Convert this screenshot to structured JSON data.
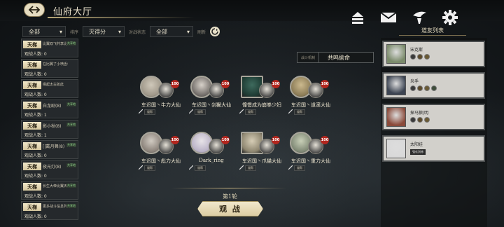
{
  "header": {
    "title": "仙府大厅"
  },
  "filters": {
    "f1": "全部",
    "label2": "排序",
    "f2": "灭得分",
    "label3": "对战状态",
    "f3": "全部",
    "label4": "刷新"
  },
  "rooms": [
    {
      "tag": "天梯",
      "name": "比翼双飞共享比翼",
      "badge": "共享地",
      "view": "观战人数: 0"
    },
    {
      "tag": "天梯",
      "name": "在比翼了小喷舌者",
      "badge": "",
      "view": "观战人数: 0"
    },
    {
      "tag": "天梯",
      "name": "缘起太古如此",
      "badge": "",
      "view": "观战人数: 0"
    },
    {
      "tag": "天梯",
      "name": "白龙剧(8)",
      "badge": "共享地",
      "view": "观战人数: 1",
      "big": true
    },
    {
      "tag": "天梯",
      "name": "影小秋(8)",
      "badge": "共享地",
      "view": "观战人数: 1",
      "big": true
    },
    {
      "tag": "天梯",
      "name": "[]戴月舞(8)",
      "badge": "共享地",
      "view": "观战人数: 0",
      "big": true
    },
    {
      "tag": "天梯",
      "name": "夜光灯(8)",
      "badge": "共享地",
      "view": "观战人数: 0",
      "big": true
    },
    {
      "tag": "天梯",
      "name": "长生大帝比翼天尊",
      "badge": "共享地",
      "view": "观战人数: 0"
    },
    {
      "tag": "天梯",
      "name": "更多战斗信息列表",
      "badge": "共享地",
      "view": "观战人数: 0"
    }
  ],
  "combat_mechanic": {
    "label": "战斗机制",
    "value": "共鸣偷命"
  },
  "fighters": [
    {
      "name": "车迟国丶牛力大仙",
      "hp": "100",
      "status": "道帮"
    },
    {
      "name": "车迟国丶剑獬大仙",
      "hp": "100",
      "status": "道帮"
    },
    {
      "name": "憧憬成为崩拳少妇",
      "hp": "100",
      "status": "道帮"
    },
    {
      "name": "车迟国丶道滚大仙",
      "hp": "100",
      "status": "道帮"
    },
    {
      "name": "车迟国丶彪力大仙",
      "hp": "100",
      "status": "道帮"
    },
    {
      "name": "Dark_ring",
      "hp": "100",
      "status": "道帮"
    },
    {
      "name": "车迟国丶爪猫大仙",
      "hp": "100",
      "status": "道帮"
    },
    {
      "name": "车迟国丶重力大仙",
      "hp": "100",
      "status": "道帮"
    }
  ],
  "round": "第1轮",
  "watch_button": "观 战",
  "right_panel": {
    "title": "道友列表",
    "friends": [
      {
        "name": "宋克斯"
      },
      {
        "name": "炎手"
      },
      {
        "name": "探马狼|明"
      },
      {
        "name": "太阳娃",
        "pill": "强化剑修"
      }
    ]
  },
  "colors": {
    "accent_gold": "#c9a64c",
    "button_cream": "#e6dcc0",
    "hp_red": "#b3261e"
  },
  "icons": [
    "back-arrow-icon",
    "inbox-icon",
    "mail-icon",
    "mage-hat-icon",
    "gear-icon",
    "refresh-icon",
    "sword-icon"
  ]
}
